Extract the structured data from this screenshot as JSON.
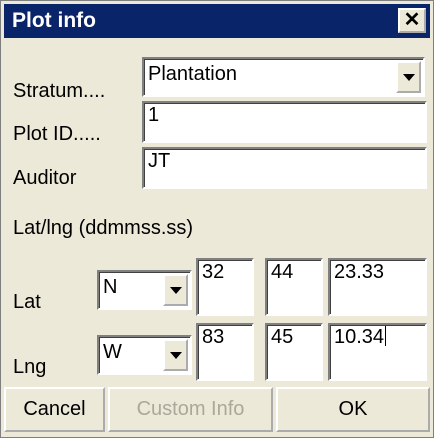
{
  "window": {
    "title": "Plot info",
    "close_label": "✕"
  },
  "labels": {
    "stratum": "Stratum....",
    "plot_id": "Plot ID.....",
    "auditor": "Auditor",
    "latlng": "Lat/lng (ddmmss.ss)",
    "lat": "Lat",
    "lng": "Lng"
  },
  "fields": {
    "stratum": "Plantation",
    "plot_id": "1",
    "auditor": "JT",
    "lat_hemisphere": "N",
    "lat_deg": "32",
    "lat_min": "44",
    "lat_sec": "23.33",
    "lng_hemisphere": "W",
    "lng_deg": "83",
    "lng_min": "45",
    "lng_sec": "10.34"
  },
  "buttons": {
    "cancel": "Cancel",
    "custom_info": "Custom Info",
    "ok": "OK"
  }
}
